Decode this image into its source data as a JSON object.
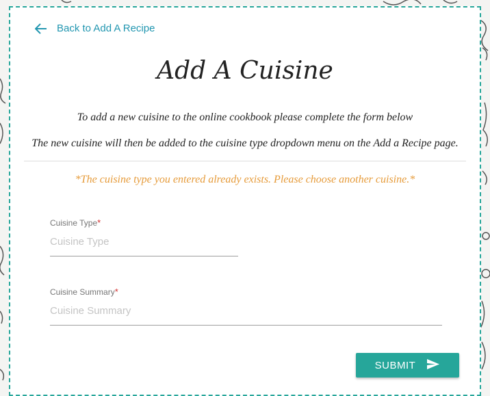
{
  "nav": {
    "back_label": "Back to Add A Recipe",
    "back_icon": "arrow-left-icon"
  },
  "page": {
    "title": "Add A Cuisine",
    "intro_line_1": "To add a new cuisine to the online cookbook please complete the form below",
    "intro_line_2": "The new cuisine will then be added to the cuisine type dropdown menu on the Add a Recipe page.",
    "error_message": "*The cuisine type you entered already exists. Please choose another cuisine.*"
  },
  "form": {
    "cuisine_type": {
      "label": "Cuisine Type",
      "required_mark": "*",
      "placeholder": "Cuisine Type",
      "value": ""
    },
    "cuisine_summary": {
      "label": "Cuisine Summary",
      "required_mark": "*",
      "placeholder": "Cuisine Summary",
      "value": ""
    },
    "submit_label": "SUBMIT",
    "submit_icon": "send-icon"
  },
  "colors": {
    "accent": "#26a69a",
    "link": "#2196b0",
    "warning": "#e69b3a",
    "required": "#d32f2f"
  }
}
